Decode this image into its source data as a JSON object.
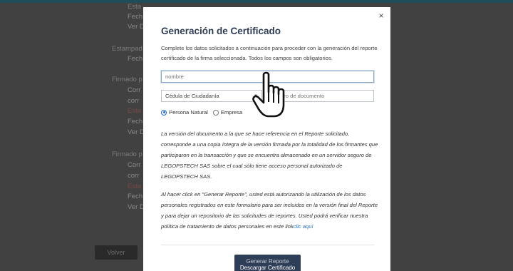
{
  "background": {
    "items": [
      {
        "text": "Esta",
        "cls": "sec"
      },
      {
        "text": "Fech",
        "cls": ""
      },
      {
        "text": "Ver D",
        "cls": ""
      },
      {
        "text": "Estampad",
        "cls": "sec"
      },
      {
        "text": "Fech",
        "cls": ""
      },
      {
        "text": "Firmado p",
        "cls": "sec"
      },
      {
        "text": "Corr",
        "cls": ""
      },
      {
        "text": "corr",
        "cls": ""
      },
      {
        "text": "Esta",
        "cls": "red"
      },
      {
        "text": "Fech",
        "cls": ""
      },
      {
        "text": "Ver D",
        "cls": ""
      },
      {
        "text": "Firmado p",
        "cls": "sec"
      },
      {
        "text": "Corr",
        "cls": ""
      },
      {
        "text": "corr",
        "cls": ""
      },
      {
        "text": "Esta",
        "cls": "red"
      },
      {
        "text": "Fech",
        "cls": ""
      },
      {
        "text": "Ver D",
        "cls": ""
      }
    ],
    "back_button": "Volver"
  },
  "modal": {
    "close_label": "×",
    "title": "Generación de Certificado",
    "intro": "Complete los datos solicitados a continuación para proceder con la generación del reporte certificado de la firma seleccionada. Todos los campos son obligatorios.",
    "name_placeholder": "nombre",
    "doc_type_selected": "Cédula de Ciudadanía",
    "doc_number_placeholder": "Número de documento",
    "radio_natural": "Persona Natural",
    "radio_empresa": "Empresa",
    "selected_person_type": "natural",
    "paragraph1": "La versión del documento a la que se hace referencia en el Reporte solicitado, corresponde a una copia íntegra de la versión firmada por la totalidad de los firmantes que participaron en la transacción y que se encuentra almacenado en un servidor seguro de LEGOPSTECH SAS sobre el cual sólo tiene acceso personal autorizado de LEGOPSTECH SAS.",
    "paragraph2_text": "Al hacer click en \"Generar Reporte\", usted está autorizando la utilización de los datos personales registrados en este formulario para ser incluidos en la versión final del Reporte y para dejar un repositorio de las solicitudes de reportes. Usted podrá verificar nuestra política de tratamiento de datos personales en este link",
    "paragraph2_link": "clic aquí",
    "submit_line1": "Generar Reporte",
    "submit_line2": "Descargar Certificado"
  },
  "colors": {
    "title": "#2f3e57",
    "button": "#2f3e57",
    "link": "#2a72c9",
    "overlay": "#414141"
  },
  "cursor_icon": "hand-pointer-icon"
}
